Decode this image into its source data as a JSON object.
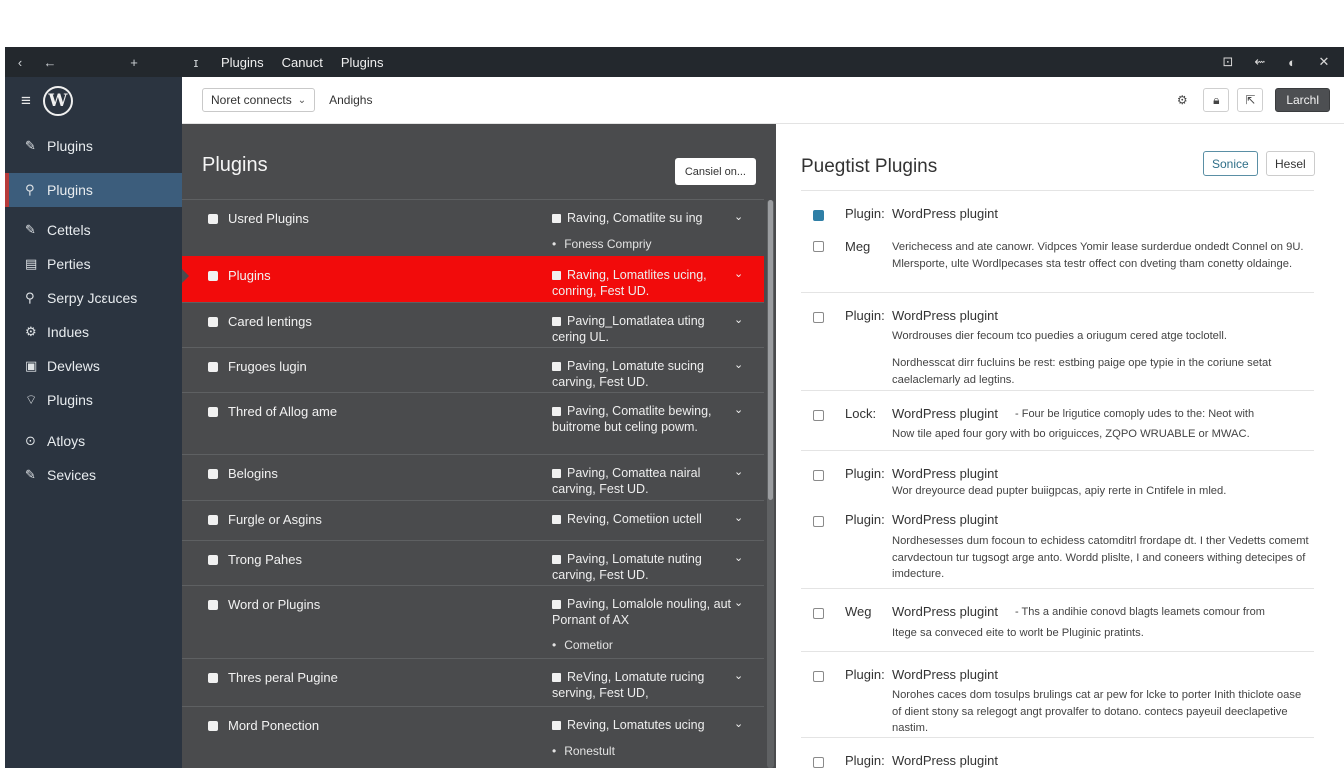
{
  "topbar": {
    "nav_icons": [
      "‹",
      "←",
      "+",
      "ɪ"
    ],
    "crumbs": [
      "Plugins",
      "Canuct",
      "Plugins"
    ],
    "right_icons": [
      "⊡",
      "⇜",
      "◐",
      "✕"
    ]
  },
  "sidebar": {
    "items": [
      {
        "icon": "✎",
        "label": "Plugins"
      },
      {
        "icon": "⚲",
        "label": "Plugins"
      },
      {
        "icon": "✎",
        "label": "Cettels"
      },
      {
        "icon": "▤",
        "label": "Perties"
      },
      {
        "icon": "⚲",
        "label": "Serpy Jcεuces"
      },
      {
        "icon": "⚙",
        "label": "Indues"
      },
      {
        "icon": "▣",
        "label": "Devlews"
      },
      {
        "icon": "⌔",
        "label": "Plugins"
      },
      {
        "icon": "⊙",
        "label": "Atloys"
      },
      {
        "icon": "✎",
        "label": "Sevices"
      }
    ]
  },
  "toolbar": {
    "select_value": "Noret connects",
    "label": "Andighs",
    "launch_label": "Larchl"
  },
  "left_panel": {
    "title": "Plugins",
    "button": "Cansiel on...",
    "rows": [
      {
        "name": "Usred Plugins",
        "desc": "Raving, Comatlite su ing",
        "sub": "Foness Compriy"
      },
      {
        "name": "Plugins",
        "desc": "Raving, Lomatlites ucing, conring, Fest UD."
      },
      {
        "name": "Cared lentings",
        "desc": "Paving_Lomatlatea uting cering UL."
      },
      {
        "name": "Frugoes lugin",
        "desc": "Paving, Lomatute sucing carving, Fest UD."
      },
      {
        "name": "Thred of Allog ame",
        "desc": "Paving, Comatlite bewing, buitrome but celing powm."
      },
      {
        "name": "Belogins",
        "desc": "Paving, Comattea nairal carving, Fest UD."
      },
      {
        "name": "Furgle or Asgins",
        "desc": "Reving, Cometiion uctell"
      },
      {
        "name": "Trong Pahes",
        "desc": "Paving, Lomatute nuting carving, Fest UD."
      },
      {
        "name": "Word or Plugins",
        "desc": "Paving, Lomalole nouling, aut Pornant of AX",
        "sub": "Cometior"
      },
      {
        "name": "Thres peral Pugine",
        "desc": "ReVing, Lomatute rucing serving, Fest UD,"
      },
      {
        "name": "Mord Ponection",
        "desc": "Reving, Lomatutes ucing",
        "sub": "Ronestult"
      }
    ]
  },
  "right_panel": {
    "title": "Puegtist Plugins",
    "primary_btn": "Sonice",
    "secondary_btn": "Hesel",
    "rows": [
      {
        "checked": true,
        "type": "Plugin:",
        "plugin": "WordPress plugint"
      },
      {
        "checked": false,
        "type": "Meg",
        "desc": "Verichecess and ate canowr. Vidpces Yomir lease surderdue ondedt Connel on 9U. Mlersporte, ulte Wordlpecases sta testr offect con dveting tham conetty oldainge."
      },
      {
        "checked": false,
        "type": "Plugin:",
        "plugin": "WordPress plugint",
        "desc": "Wordrouses dier fecoum tco puedies a oriugum cered atge toclotell.",
        "desc2": "Nordhesscat dirr fucluins be rest: estbing paige ope typie in the coriune setat caelaclemarly ad legtins."
      },
      {
        "checked": false,
        "type": "Lock:",
        "plugin": "WordPress plugint",
        "inline": "- Four be lrigutice comoply udes to the: Neot with",
        "desc": "Now tile aped four gory with bo origuicces, ZQPO WRUABLE or MWAC."
      },
      {
        "checked": false,
        "type": "Plugin:",
        "plugin": "WordPress plugint",
        "desc": "Wor dreyource dead pupter buiigpcas, apiy rerte in Cntifele in mled."
      },
      {
        "checked": false,
        "type": "Plugin:",
        "plugin": "WordPress plugint",
        "desc": "Nordhesesses dum focoun to echidess catomditrl frordape dt. I ther Vedetts comemt carvdectoun tur tugsogt arge anto. Wordd plislte, I and coneers withing detecipes of imdecture."
      },
      {
        "checked": false,
        "type": "Weg",
        "plugin": "WordPress plugint",
        "inline": "- Ths a andihie conovd blagts leamets comour from",
        "desc": "Itege sa conveced eite to worlt be Pluginic pratints."
      },
      {
        "checked": false,
        "type": "Plugin:",
        "plugin": "WordPress plugint",
        "desc": "Norohes caces dom tosulps brulings cat ar pew for lcke to porter Inith thiclote oase of dient stony sa relegogt angt provalfer to dotano. contecs payeuil deeclapetive nastim."
      },
      {
        "checked": false,
        "type": "Plugin:",
        "plugin": "WordPress plugint"
      }
    ]
  }
}
